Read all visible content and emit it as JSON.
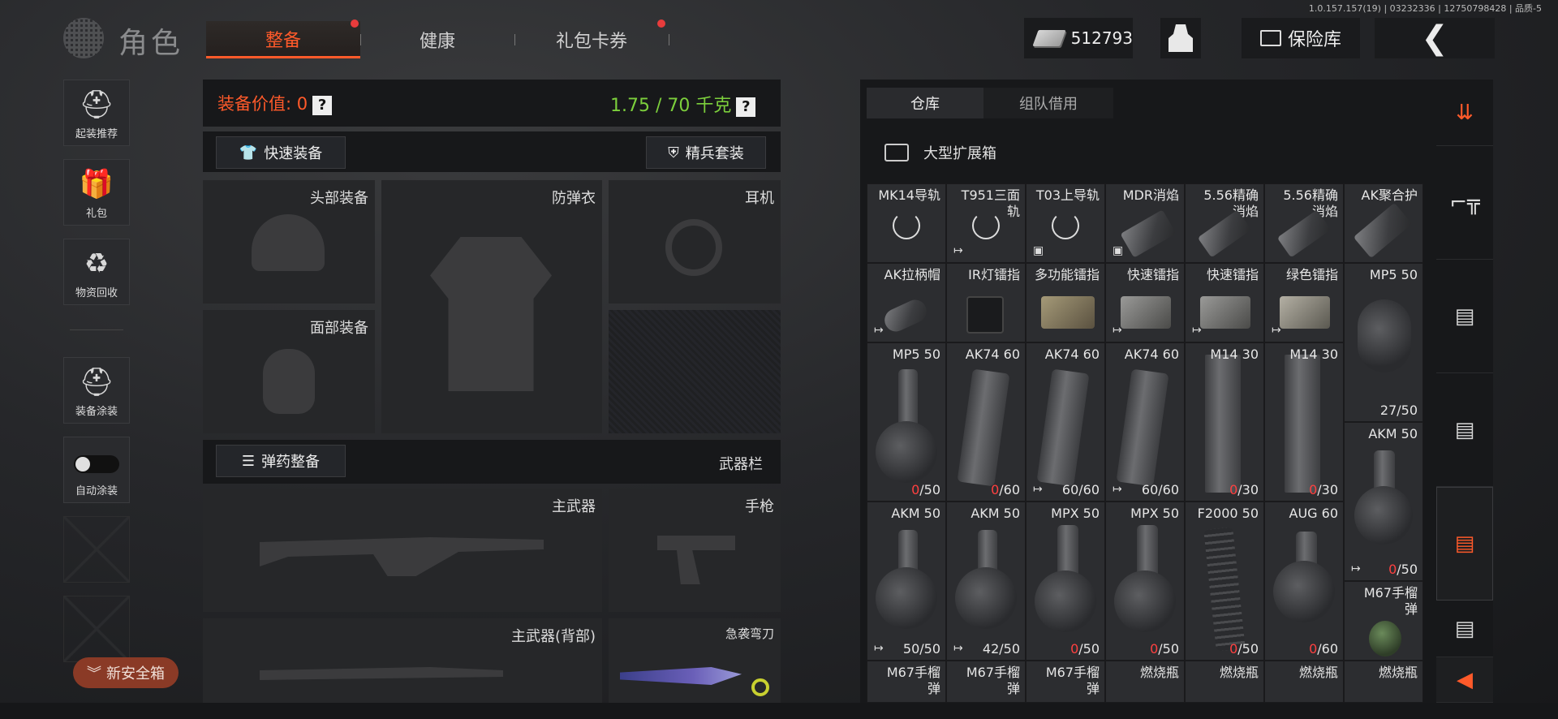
{
  "version": "1.0.157.157(19) | 03232336 | 12750798428 | 品质-5",
  "header": {
    "title": "角色",
    "tabs": [
      {
        "label": "整备",
        "active": true,
        "dot": true
      },
      {
        "label": "健康",
        "active": false,
        "dot": false
      },
      {
        "label": "礼包卡券",
        "active": false,
        "dot": true
      }
    ],
    "money": "512793",
    "vault_label": "保险库"
  },
  "sidebar": {
    "items": [
      {
        "label": "起装推荐",
        "icon": "soldier-gear-icon"
      },
      {
        "label": "礼包",
        "icon": "gift-icon"
      },
      {
        "label": "物资回收",
        "icon": "recycle-icon"
      },
      {
        "label": "装备涂装",
        "icon": "helmet-paint-icon"
      },
      {
        "label": "自动涂装",
        "icon": "toggle-icon"
      }
    ],
    "safebox_label": "新安全箱"
  },
  "loadout": {
    "value_label": "装备价值: 0",
    "weight": "1.75 / 70 千克",
    "quick_equip": "快速装备",
    "elite_set": "精兵套装",
    "slots": {
      "head": "头部装备",
      "armor": "防弹衣",
      "headset": "耳机",
      "face": "面部装备"
    },
    "ammo_btn": "弹药整备",
    "weapon_bar": "武器栏",
    "weapons": {
      "primary": "主武器",
      "pistol": "手枪",
      "primary_back": "主武器(背部)",
      "melee": "急袭弯刀"
    }
  },
  "storage": {
    "tabs": [
      "仓库",
      "组队借用"
    ],
    "box_title": "大型扩展箱",
    "rows": [
      [
        {
          "name": "MK14导轨",
          "kind": "ring"
        },
        {
          "name": "T951三面\n轨",
          "kind": "ring",
          "mark": "↦"
        },
        {
          "name": "T03上导轨",
          "kind": "ring",
          "mark": "▣"
        },
        {
          "name": "MDR消焰",
          "kind": "part",
          "mark": "▣"
        },
        {
          "name": "5.56精确\n消焰",
          "kind": "part"
        },
        {
          "name": "5.56精确\n消焰",
          "kind": "part"
        },
        {
          "name": "AK聚合护",
          "kind": "part"
        }
      ],
      [
        {
          "name": "AK拉柄帽",
          "kind": "part",
          "mark": "↦"
        },
        {
          "name": "IR灯镭指",
          "kind": "part"
        },
        {
          "name": "多功能镭指",
          "kind": "part"
        },
        {
          "name": "快速镭指",
          "kind": "part",
          "mark": "↦"
        },
        {
          "name": "快速镭指",
          "kind": "part",
          "mark": "↦"
        },
        {
          "name": "绿色镭指",
          "kind": "part",
          "mark": "↦"
        },
        {
          "name": "MP5 50",
          "kind": "drum",
          "count": "27/50"
        }
      ]
    ],
    "mags": [
      {
        "name": "MP5 50",
        "kind": "drum",
        "count_red": "0",
        "count_rest": "/50"
      },
      {
        "name": "AK74 60",
        "kind": "mag",
        "count_red": "0",
        "count_rest": "/60"
      },
      {
        "name": "AK74 60",
        "kind": "mag",
        "count_red": "",
        "count_rest": "60/60",
        "mark": "↦"
      },
      {
        "name": "AK74 60",
        "kind": "mag",
        "count_red": "",
        "count_rest": "60/60",
        "mark": "↦"
      },
      {
        "name": "M14 30",
        "kind": "mag",
        "count_red": "0",
        "count_rest": "/30"
      },
      {
        "name": "M14 30",
        "kind": "mag",
        "count_red": "0",
        "count_rest": "/30"
      }
    ],
    "akm_side": {
      "name": "AKM 50",
      "count_red": "0",
      "count_rest": "/50"
    },
    "row4": [
      {
        "name": "AKM 50",
        "kind": "drum",
        "count_red": "",
        "count_rest": "50/50",
        "mark": "↦"
      },
      {
        "name": "AKM 50",
        "kind": "drum",
        "count_red": "",
        "count_rest": "42/50",
        "mark": "↦"
      },
      {
        "name": "MPX 50",
        "kind": "drum",
        "count_red": "0",
        "count_rest": "/50"
      },
      {
        "name": "MPX 50",
        "kind": "drum",
        "count_red": "0",
        "count_rest": "/50"
      },
      {
        "name": "F2000 50",
        "kind": "mag",
        "count_red": "0",
        "count_rest": "/50"
      },
      {
        "name": "AUG 60",
        "kind": "drum",
        "count_red": "0",
        "count_rest": "/60"
      }
    ],
    "grenade_side": {
      "name": "M67手榴\n弹"
    },
    "row5": [
      {
        "name": "M67手榴\n弹"
      },
      {
        "name": "M67手榴\n弹"
      },
      {
        "name": "M67手榴\n弹"
      },
      {
        "name": "燃烧瓶"
      },
      {
        "name": "燃烧瓶"
      },
      {
        "name": "燃烧瓶"
      },
      {
        "name": "燃烧瓶"
      }
    ]
  },
  "colors": {
    "accent": "#ff5a2a",
    "weight": "#7ccf3c",
    "empty": "#ff4040"
  }
}
